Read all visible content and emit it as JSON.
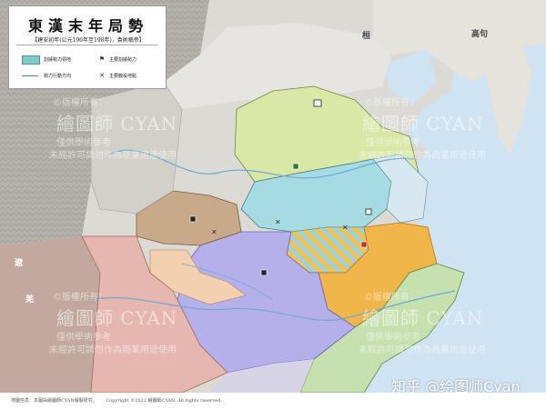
{
  "legend": {
    "title": "東漢末年局勢",
    "subtitle": "【建安初年(公元196年至198年)，袁術稱帝】",
    "items": [
      {
        "label": "割據勢力領地",
        "icon": "territory-swatch-icon"
      },
      {
        "label": "主要割據勢力",
        "icon": "faction-seat-icon"
      },
      {
        "label": "勢力行動方向",
        "icon": "movement-arrow-icon"
      },
      {
        "label": "主要戰役地點",
        "icon": "battle-site-icon"
      }
    ]
  },
  "places": {
    "gaogouli": "高句",
    "wuhuan": "桓",
    "liao": "遼",
    "qiang": "羌"
  },
  "watermarks": {
    "rights": "©版權所有：",
    "name": "繪圖師 CYAN",
    "ref": "僅供學術參考",
    "no_commercial": "未經許可請勿作為商業用途使用"
  },
  "zhihu": "知乎 @绘图师Cyan",
  "footer": {
    "source": "地圖信息：本圖由繪圖師CYAN繪製研究。",
    "copyright": "Copyright ©2022 繪圖師CYAN. All rights reserved."
  },
  "colors": {
    "sea": "#cfe3f3",
    "mountains": "#b9b6b0",
    "plain": "#e4e2de",
    "ji_yuan_shao": "#d9e8a7",
    "cao_cao": "#a6dbe3",
    "lu_bu_hatch": "#9fd0de",
    "yuan_shu": "#f0b64a",
    "liu_biao": "#b6b0ea",
    "guanzhong": "#c8a989",
    "hanzhong": "#f3d0b0",
    "yizhou": "#e5b7b0",
    "sun_ce": "#c6e0b0",
    "yan_liang": "#d8d4e8"
  }
}
